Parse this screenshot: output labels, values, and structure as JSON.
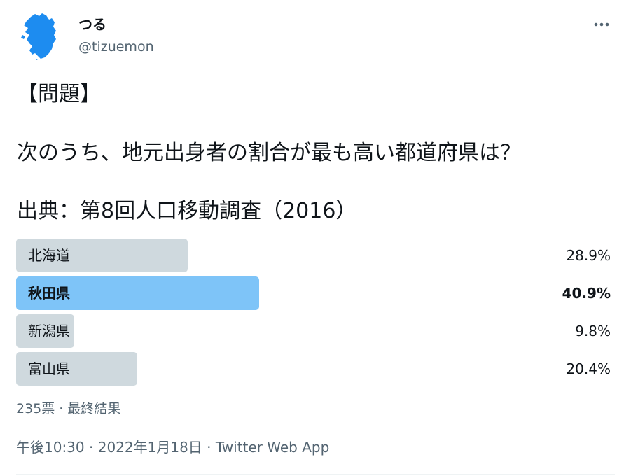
{
  "author": {
    "display_name": "つる",
    "handle": "@tizuemon",
    "avatar_icon": "kyushu-map-icon",
    "avatar_color": "#1d8cf0"
  },
  "menu": {
    "more_icon": "more-horizontal-icon"
  },
  "tweet": {
    "line1": "【問題】",
    "line2": "次のうち、地元出身者の割合が最も高い都道府県は？",
    "line3": "出典：第8回人口移動調査（2016）"
  },
  "poll": {
    "options": [
      {
        "label": "北海道",
        "percent_text": "28.9%",
        "percent": 28.9,
        "winner": false
      },
      {
        "label": "秋田県",
        "percent_text": "40.9%",
        "percent": 40.9,
        "winner": true
      },
      {
        "label": "新潟県",
        "percent_text": "9.8%",
        "percent": 9.8,
        "winner": false
      },
      {
        "label": "富山県",
        "percent_text": "20.4%",
        "percent": 20.4,
        "winner": false
      }
    ],
    "votes": "235票",
    "separator": " · ",
    "status": "最終結果",
    "colors": {
      "bar": "#cfd9de",
      "winner_bar": "#7ec4f8"
    }
  },
  "meta": {
    "time": "午後10:30",
    "separator1": " · ",
    "date": "2022年1月18日",
    "separator2": " · ",
    "source": "Twitter Web App"
  }
}
